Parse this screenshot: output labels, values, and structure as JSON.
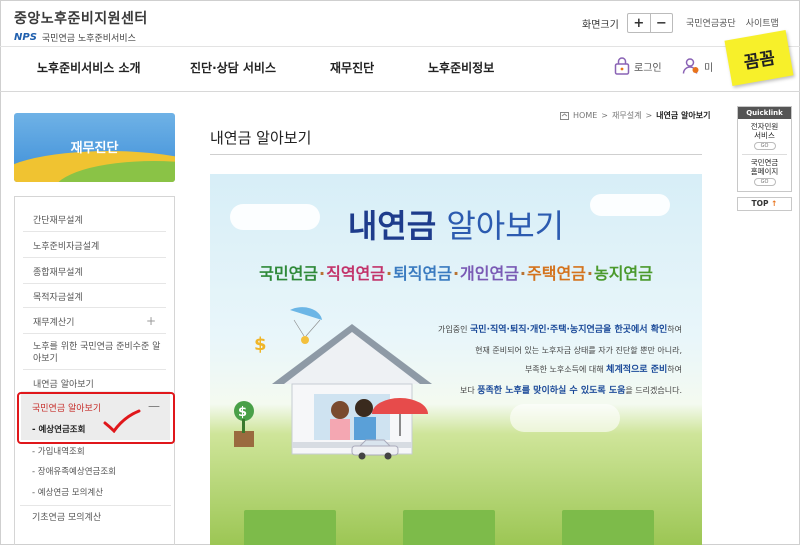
{
  "header": {
    "site_title": "중앙노후준비지원센터",
    "nps_mark": "NPS",
    "nps_sub": "국민연금 노후준비서비스",
    "fontsize_label": "화면크기",
    "fontsize_plus": "+",
    "fontsize_minus": "−",
    "link_nps": "국민연금공단",
    "link_sitemap": "사이트맵",
    "login": "로그인",
    "join_cut": "미",
    "sticker": "꼼꼼"
  },
  "gnb": {
    "items": [
      "노후준비서비스 소개",
      "진단·상담 서비스",
      "재무진단",
      "노후준비정보"
    ]
  },
  "sidebar": {
    "banner": "재무진단",
    "items": [
      "간단재무설계",
      "노후준비자금설계",
      "종합재무설계",
      "목적자금설계",
      "재무계산기",
      "노후를 위한 국민연금 준비수준 알",
      "아보기",
      "내연금 알아보기"
    ],
    "plus": "+",
    "active": "국민연금 알아보기",
    "active_minus": "—",
    "sub_items": [
      "- 예상연금조회",
      "- 가입내역조회",
      "- 장애유족예상연금조회",
      "- 예상연금 모의계산"
    ],
    "last_item": "기초연금 모의계산"
  },
  "breadcrumb": {
    "home": "HOME",
    "sep": ">",
    "mid": "재무설계",
    "current": "내연금 알아보기"
  },
  "content": {
    "page_title": "내연금 알아보기",
    "hero_title_bold": "내연금",
    "hero_title_light": " 알아보기",
    "tags": [
      "국민연금",
      "직역연금",
      "퇴직연금",
      "개인연금",
      "주택연금",
      "농지연금"
    ],
    "tag_dot": "·",
    "copy": {
      "l1_pre": "가입중인 ",
      "l1_bold": "국민·직역·퇴직·개인·주택·농지연금을 한곳에서 확인",
      "l1_post": "하여",
      "l2": "현재 준비되어 있는 노후자금 상태를 자가 진단할 뿐만 아니라,",
      "l3_pre": "부족한 노후소득에 대해 ",
      "l3_bold": "체계적으로 준비",
      "l3_post": "하여",
      "l4_pre": "보다 ",
      "l4_bold": "풍족한 노후를 맞이하실 수 있도록 도움",
      "l4_post": "을 드리겠습니다."
    }
  },
  "quicklink": {
    "header": "Quicklink",
    "link1_l1": "전자민원",
    "link1_l2": "서비스",
    "go": "GO",
    "link2_l1": "국민연금",
    "link2_l2": "홈페이지",
    "top": "TOP",
    "top_arrow": "↑"
  },
  "colors": {
    "hero_title": "#1e3c8c",
    "active_red": "#c7302d",
    "highlight_box": "#e0171b",
    "sticker": "#f7f02a",
    "tag_colors": [
      "#2f8a3a",
      "#c2336a",
      "#3a7bc0",
      "#7a5ab5",
      "#d4731d",
      "#4b9a2d"
    ]
  }
}
